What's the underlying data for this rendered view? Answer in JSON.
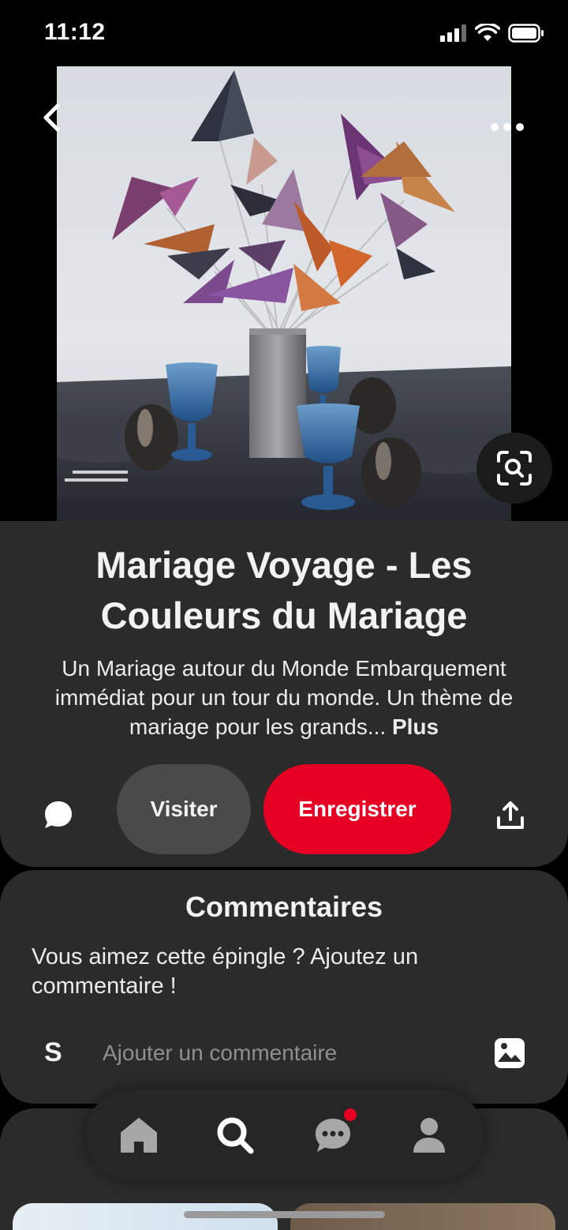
{
  "status_bar": {
    "time": "11:12"
  },
  "pin": {
    "title": "Mariage Voyage - Les Couleurs du Mariage",
    "description": "Un Mariage autour du Monde Embarquement immédiat pour un tour du monde. Un thème de mariage pour les grands...",
    "more_label": "Plus"
  },
  "actions": {
    "visit_label": "Visiter",
    "save_label": "Enregistrer"
  },
  "comments": {
    "title": "Commentaires",
    "prompt": "Vous aimez cette épingle ? Ajoutez un commentaire !",
    "avatar_initial": "S",
    "input_placeholder": "Ajouter un commentaire"
  },
  "tab_bar": {
    "items": [
      "home-icon",
      "search-icon",
      "messages-icon",
      "profile-icon"
    ],
    "active": "search-icon"
  },
  "colors": {
    "accent": "#e60023",
    "card": "#2b2b2b",
    "background": "#000000"
  }
}
